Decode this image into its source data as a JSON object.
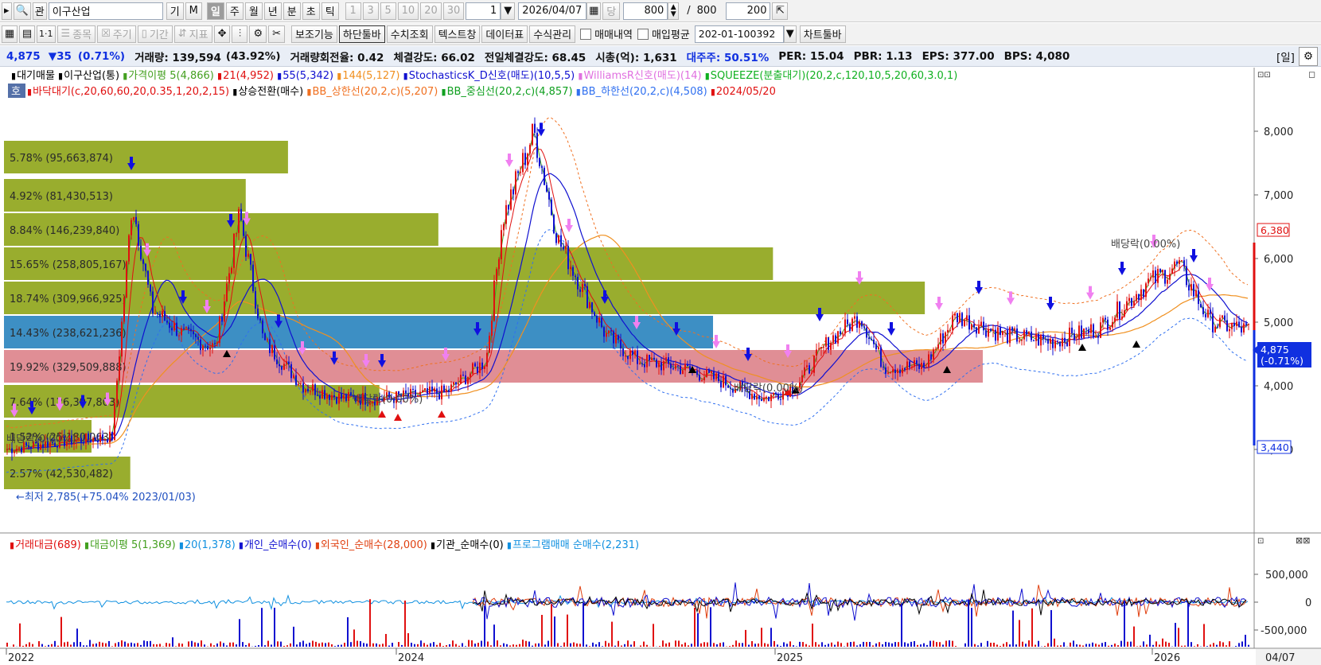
{
  "toolbar1": {
    "stock_name": "이구산업",
    "btn_gi": "기",
    "btn_m": "M",
    "periods": [
      "일",
      "주",
      "월",
      "년",
      "분",
      "초",
      "틱"
    ],
    "active_period": "일",
    "numbers": [
      "1",
      "3",
      "5",
      "10",
      "20",
      "30"
    ],
    "count_value": "1",
    "date_value": "2026/04/07",
    "dang_label": "당",
    "view_count": "800",
    "slash": "/",
    "total_count": "800",
    "extra_value": "200"
  },
  "toolbar2": {
    "disabled_buttons": [
      "종목",
      "주기",
      "기간",
      "지표"
    ],
    "buttons": [
      "보조기능",
      "하단툴바",
      "수치조회",
      "텍스트창",
      "데이터표",
      "수식관리"
    ],
    "check_trades": "매매내역",
    "check_avg": "매입평균",
    "account": "202-01-100392",
    "chart_toolbar": "차트툴바"
  },
  "info": {
    "price": "4,875",
    "change": "▼35",
    "change_pct": "(0.71%)",
    "volume": "거래량: 139,594",
    "volume_pct": "(43.92%)",
    "turnover": "거래량회전율: 0.42",
    "strength": "체결강도: 66.02",
    "prev_strength": "전일체결강도: 68.45",
    "mcap": "시총(억): 1,631",
    "major_holder": "대주주: 50.51%",
    "per": "PER: 15.04",
    "pbr": "PBR: 1.13",
    "eps": "EPS: 377.00",
    "bps": "BPS: 4,080",
    "period_tag": "[일]"
  },
  "colors": {
    "olive": "#99ad2e",
    "blue_band": "#3d8fc4",
    "pink_band": "#e08e95",
    "down_blue": "#1010e0",
    "up_red": "#e01010",
    "price_box": "#1030e0"
  },
  "legend1": [
    {
      "text": "대기매물",
      "color": "#000000"
    },
    {
      "text": "이구산업(통)",
      "color": "#000000"
    },
    {
      "text": "가격이평 5(4,866)",
      "color": "#44a020"
    },
    {
      "text": "21(4,952)",
      "color": "#e01010"
    },
    {
      "text": "55(5,342)",
      "color": "#1010d0"
    },
    {
      "text": "144(5,127)",
      "color": "#f09020"
    },
    {
      "text": "StochasticsK_D신호(매도)(10,5,5)",
      "color": "#1010d0"
    },
    {
      "text": "WilliamsR신호(매도)(14)",
      "color": "#e070e0"
    },
    {
      "text": "SQUEEZE(분출대기)(20,2,c,120,10,5,20,60,3.0,1)",
      "color": "#10b020"
    }
  ],
  "legend2": [
    {
      "text": "바닥대기(c,20,60,60,20,0.35,1,20,2,15)",
      "color": "#e01010"
    },
    {
      "text": "상승전환(매수)",
      "color": "#000000"
    },
    {
      "text": "BB_상한선(20,2,c)(5,207)",
      "color": "#f07020"
    },
    {
      "text": "BB_중심선(20,2,c)(4,857)",
      "color": "#10a020"
    },
    {
      "text": "BB_하한선(20,2,c)(4,508)",
      "color": "#3070f0"
    },
    {
      "text": "2024/05/20",
      "color": "#e01010"
    }
  ],
  "ho_tag": "호",
  "volume_profile": [
    {
      "label": "5.78% (95,663,874)",
      "pct": 5.78,
      "color": "olive"
    },
    {
      "label": "4.92% (81,430,513)",
      "pct": 4.92,
      "color": "olive"
    },
    {
      "label": "8.84% (146,239,840)",
      "pct": 8.84,
      "color": "olive"
    },
    {
      "label": "15.65% (258,805,167)",
      "pct": 15.65,
      "color": "olive"
    },
    {
      "label": "18.74% (309,966,925)",
      "pct": 18.74,
      "color": "olive"
    },
    {
      "label": "14.43% (238,621,236)",
      "pct": 14.43,
      "color": "blue"
    },
    {
      "label": "19.92% (329,509,888)",
      "pct": 19.92,
      "color": "pink"
    },
    {
      "label": "7.64% (126,397,803)",
      "pct": 7.64,
      "color": "olive"
    },
    {
      "label": "1.52% (25,180,063)",
      "pct": 1.52,
      "color": "olive"
    },
    {
      "label": "2.57% (42,530,482)",
      "pct": 2.57,
      "color": "olive"
    }
  ],
  "price_axis": [
    "8,000",
    "7,000",
    "6,000",
    "5,000",
    "4,000",
    "3,000"
  ],
  "price_high_tag": "6,380",
  "price_current_tag": "4,875",
  "price_current_pct": "(-0.71%)",
  "price_low_tag": "3,440",
  "annotations": {
    "low_note": "←최저 2,785(+75.04% 2023/01/03)",
    "div1": "배당락(0.00%)",
    "div2": "배당락(0.00%)",
    "div3": "배당락(0.00%)",
    "div4": "배당락(0.00%)"
  },
  "legend3": [
    {
      "text": "거래대금(689)",
      "color": "#e01010"
    },
    {
      "text": "대금이평 5(1,369)",
      "color": "#44a020"
    },
    {
      "text": "20(1,378)",
      "color": "#1090e0"
    },
    {
      "text": "개인_순매수(0)",
      "color": "#1010d0"
    },
    {
      "text": "외국인_순매수(28,000)",
      "color": "#e04010"
    },
    {
      "text": "기관_순매수(0)",
      "color": "#000000"
    },
    {
      "text": "프로그램매매 순매수(2,231)",
      "color": "#1090e0"
    }
  ],
  "sub_axis": [
    "500,000",
    "0",
    "-500,000"
  ],
  "x_axis": [
    "2022",
    "2024",
    "2025",
    "2026"
  ],
  "x_last_date": "04/07",
  "icons": {
    "search": "search-icon",
    "settings": "gear-icon"
  }
}
